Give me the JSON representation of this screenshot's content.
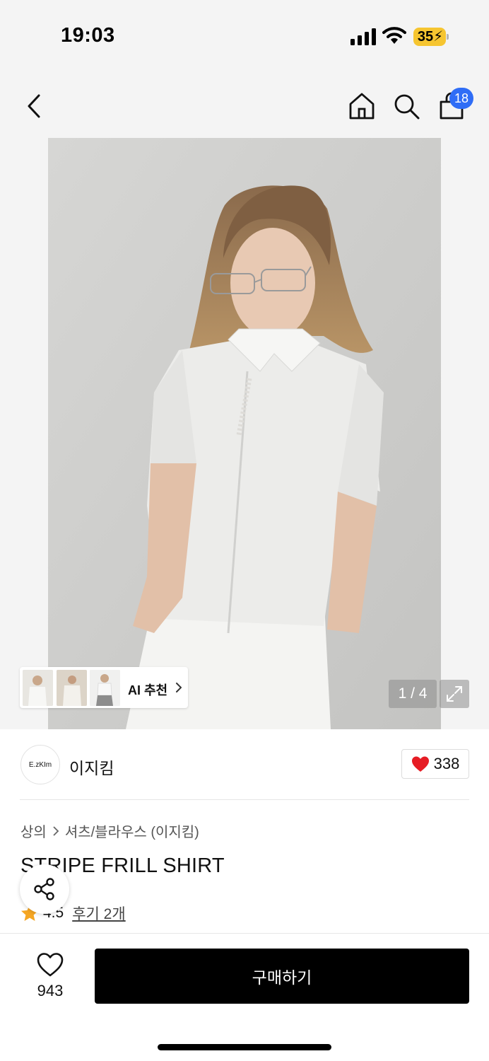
{
  "status_bar": {
    "time": "19:03",
    "battery": "35",
    "icons": [
      "signal-icon",
      "wifi-icon",
      "battery-charging-icon"
    ]
  },
  "nav": {
    "icons": [
      "back-icon",
      "home-icon",
      "search-icon",
      "shopping-bag-icon"
    ],
    "cart_count": "18"
  },
  "gallery": {
    "counter": "1 / 4",
    "ai_recommend_label": "AI 추천",
    "icons": [
      "expand-icon",
      "chevron-right-icon"
    ]
  },
  "brand": {
    "logo_text": "E.zKIm",
    "name": "이지킴",
    "likes": "338",
    "like_color": "#e61c24"
  },
  "breadcrumb": {
    "level1": "상의",
    "level2": "셔츠/블라우스 (이지킴)"
  },
  "product": {
    "title": "STRIPE FRILL SHIRT",
    "rating": "4.5",
    "reviews": "후기 2개",
    "star_color": "#f5a623"
  },
  "bottom_bar": {
    "wish_count": "943",
    "buy_label": "구매하기"
  },
  "colors": {
    "badge": "#2f6df6",
    "buy_button": "#000000",
    "battery": "#f6c530"
  }
}
